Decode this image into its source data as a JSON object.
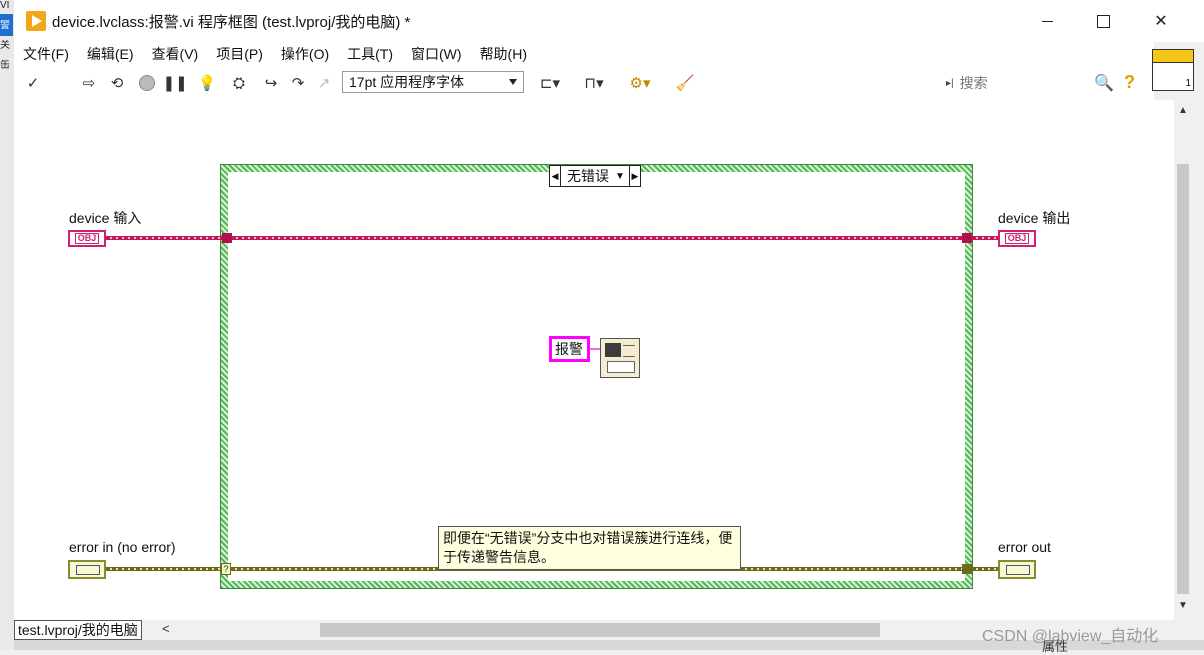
{
  "window": {
    "title": "device.lvclass:报警.vi 程序框图 (test.lvproj/我的电脑)  *",
    "controls": {
      "minimize": "—",
      "maximize": "☐",
      "close": "✕"
    }
  },
  "side_window": {
    "labels": [
      "VI",
      "警",
      "关",
      "缶"
    ]
  },
  "menu": [
    {
      "label": "文件(F)"
    },
    {
      "label": "编辑(E)"
    },
    {
      "label": "查看(V)"
    },
    {
      "label": "项目(P)"
    },
    {
      "label": "操作(O)"
    },
    {
      "label": "工具(T)"
    },
    {
      "label": "窗口(W)"
    },
    {
      "label": "帮助(H)"
    }
  ],
  "toolbar": {
    "font_select": "17pt 应用程序字体",
    "search_placeholder": "搜索",
    "help_label": "?"
  },
  "context_help": {
    "number": "1"
  },
  "diagram": {
    "case_selector": {
      "value": "无错误"
    },
    "terminals": {
      "device_in": "device 输入",
      "device_out": "device 输出",
      "error_in": "error in (no error)",
      "error_out": "error out",
      "obj_tag": "OBJ"
    },
    "string_constant": "报警",
    "comment": "即便在“无错误”分支中也对错误簇进行连线，便于传递警告信息。"
  },
  "status": {
    "path": "test.lvproj/我的电脑"
  },
  "bottom": {
    "partial_text": "属性"
  },
  "watermark": "CSDN @labview_自动化",
  "colors": {
    "obj_wire": "#c2185b",
    "error_wire": "#6b6b1a",
    "case_border": "#55b855",
    "string_const": "#ff00ff"
  }
}
